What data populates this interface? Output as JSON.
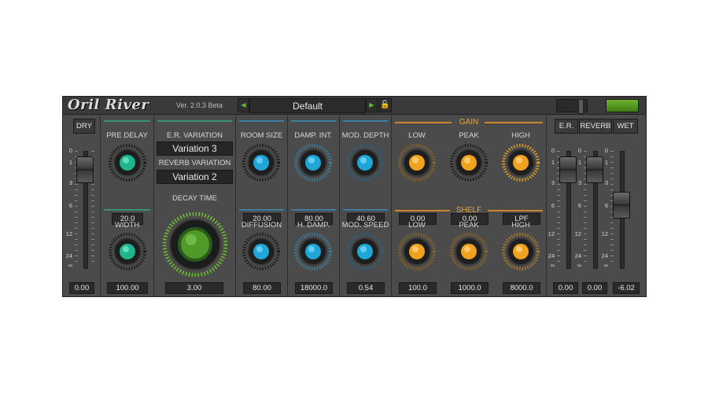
{
  "header": {
    "logo": "Oril River",
    "version": "Ver. 2.0.3 Beta",
    "preset": "Default",
    "prev_icon": "triangle-left-icon",
    "next_icon": "triangle-right-icon",
    "lock_icon": "lock-icon"
  },
  "dry": {
    "label": "DRY",
    "value": "0.00"
  },
  "scale_left": [
    "0",
    "1",
    "3",
    "6",
    "12",
    "24",
    "∞"
  ],
  "predelay": {
    "label": "PRE DELAY",
    "value": "20.0"
  },
  "width": {
    "label": "WIDTH",
    "value": "100.00"
  },
  "er_variation": {
    "label": "E.R. VARIATION",
    "value": "Variation 3"
  },
  "reverb_variation": {
    "label": "REVERB VARIATION",
    "value": "Variation 2"
  },
  "decay": {
    "label": "DECAY TIME",
    "value": "3.00"
  },
  "room_size": {
    "label": "ROOM SIZE",
    "value": "20.00"
  },
  "diffusion": {
    "label": "DIFFUSION",
    "value": "80.00"
  },
  "damp_int": {
    "label": "DAMP. INT.",
    "value": "80.00"
  },
  "h_damp": {
    "label": "H. DAMP.",
    "value": "18000.0"
  },
  "mod_depth": {
    "label": "MOD. DEPTH",
    "value": "40.60"
  },
  "mod_speed": {
    "label": "MOD. SPEED",
    "value": "0.54"
  },
  "gain": {
    "title": "GAIN",
    "low": {
      "label": "LOW",
      "value": "0.00"
    },
    "peak": {
      "label": "PEAK",
      "value": "0.00"
    },
    "high": {
      "label": "HIGH",
      "value": "LPF"
    }
  },
  "shelf": {
    "title": "SHELF",
    "low": {
      "label": "LOW",
      "value": "100.0"
    },
    "peak": {
      "label": "PEAK",
      "value": "1000.0"
    },
    "high": {
      "label": "HIGH",
      "value": "8000.0"
    }
  },
  "output": {
    "er": {
      "label": "E.R.",
      "value": "0.00"
    },
    "reverb": {
      "label": "REVERB",
      "value": "0.00"
    },
    "wet": {
      "label": "WET",
      "value": "-6.02"
    }
  },
  "colors": {
    "teal": "#1fb58e",
    "blue": "#1ea6d6",
    "orange": "#f0a21e",
    "green": "#4f9a2a",
    "accent_led": "#5fa02a"
  }
}
